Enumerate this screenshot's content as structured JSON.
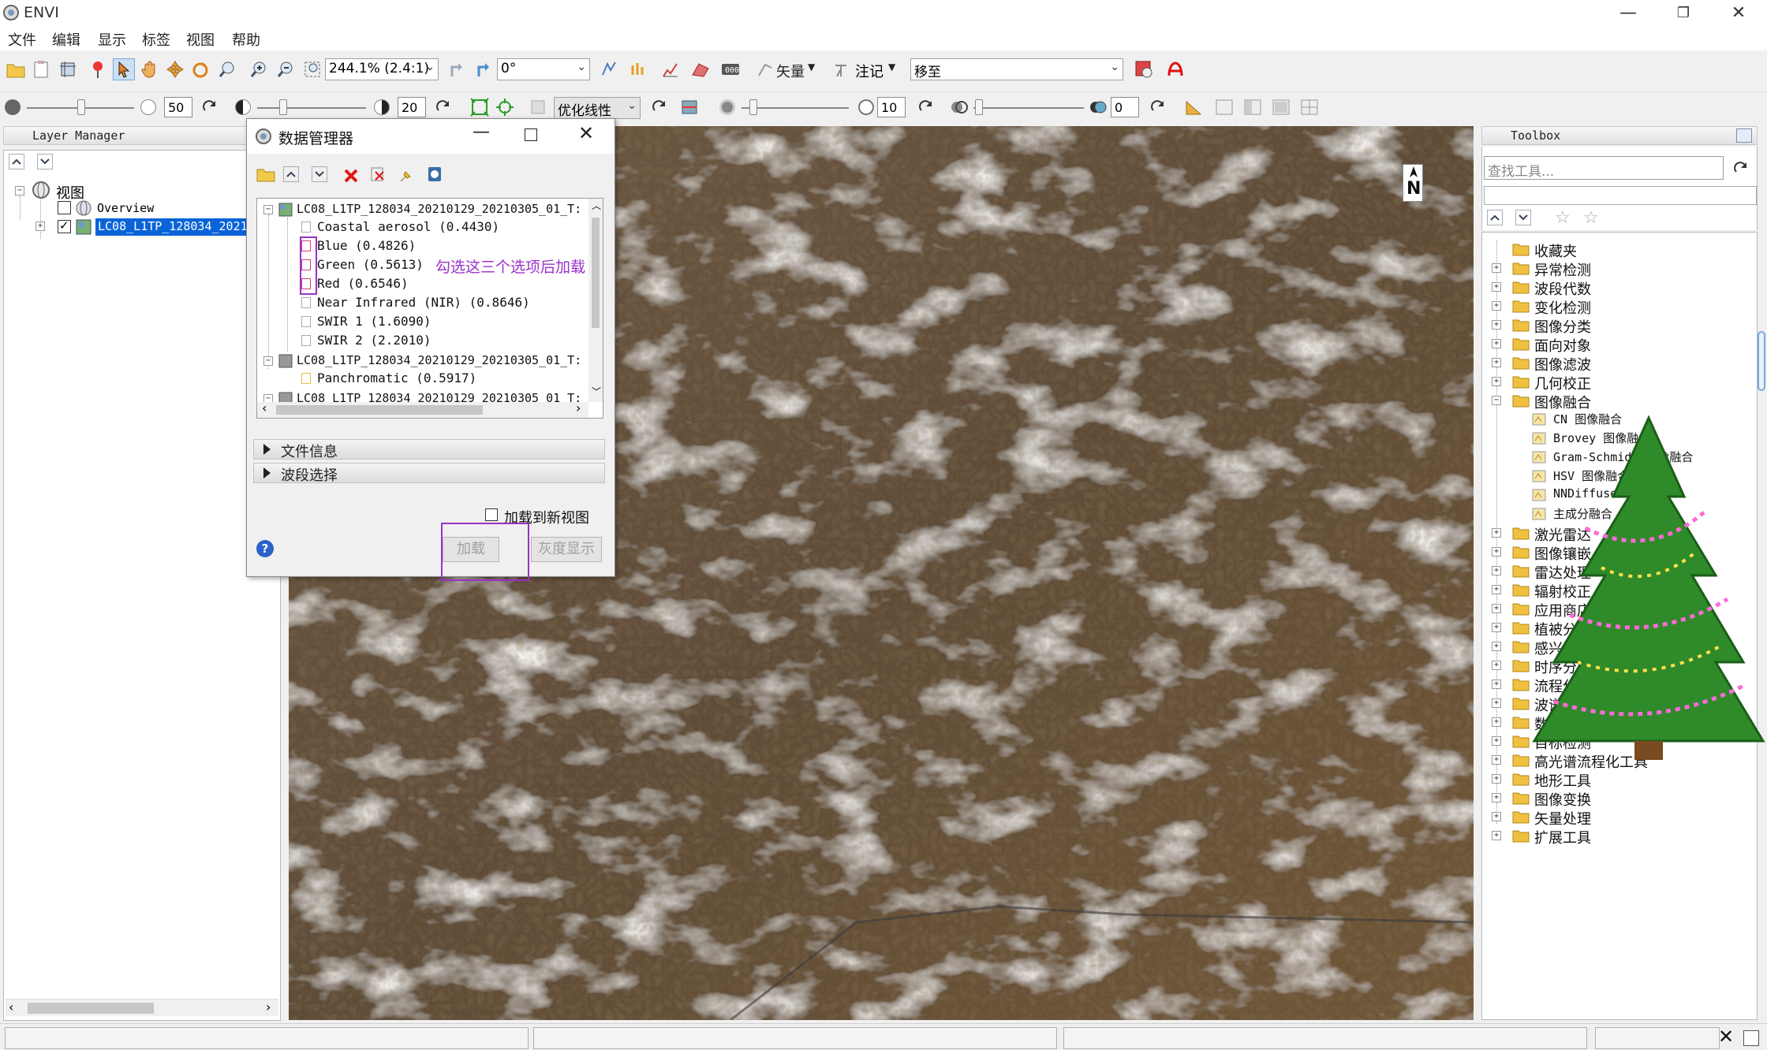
{
  "window": {
    "title": "ENVI",
    "minimize": "—",
    "restore": "❐",
    "close": "✕"
  },
  "menu": [
    "文件",
    "编辑",
    "显示",
    "标签",
    "视图",
    "帮助"
  ],
  "toolbar1": {
    "zoom_value": "244.1% (2.4:1)",
    "rotation_value": "0°",
    "vector_label": "矢量",
    "annotation_label": "注记",
    "goto_value": "移至"
  },
  "toolbar2": {
    "brightness_value": "50",
    "contrast_value": "20",
    "stretch_value": "优化线性",
    "sharpen_value": "10",
    "transparency_value": "0"
  },
  "layer_manager": {
    "title": "Layer Manager",
    "root": "视图",
    "items": [
      "Overview",
      "LC08_L1TP_128034_2021"
    ]
  },
  "data_manager": {
    "title": "数据管理器",
    "files": [
      {
        "name": "LC08_L1TP_128034_20210129_20210305_01_T:",
        "bands": [
          "Coastal aerosol (0.4430)",
          "Blue (0.4826)",
          "Green (0.5613)",
          "Red (0.6546)",
          "Near Infrared (NIR) (0.8646)",
          "SWIR 1 (1.6090)",
          "SWIR 2 (2.2010)"
        ]
      },
      {
        "name": "LC08_L1TP_128034_20210129_20210305_01_T:",
        "bands": [
          "Panchromatic (0.5917)"
        ]
      },
      {
        "name": "LC08_L1TP_128034_20210129_20210305_01_T:",
        "bands": []
      }
    ],
    "annotation": "勾选这三个选项后加载",
    "sections": [
      "文件信息",
      "波段选择"
    ],
    "load_new_view": "加载到新视图",
    "load_button": "加载",
    "gray_button": "灰度显示",
    "help": "?"
  },
  "toolbox": {
    "title": "Toolbox",
    "search_placeholder": "查找工具...",
    "folders": [
      "收藏夹",
      "异常检测",
      "波段代数",
      "变化检测",
      "图像分类",
      "面向对象",
      "图像滤波",
      "几何校正",
      "图像融合"
    ],
    "fusion_children": [
      "CN 图像融合",
      "Brovey 图像融合",
      "Gram-Schmidt 图像融合",
      "HSV 图像融合",
      "NNDiffuse",
      "主成分融合"
    ],
    "folders_after": [
      "激光雷达",
      "图像镶嵌",
      "雷达处理",
      "辐射校正",
      "应用商店",
      "植被分析",
      "感兴趣区",
      "时序分析",
      "流程化",
      "波谱分析",
      "数据统计",
      "目标检测",
      "高光谱流程化工具",
      "地形工具",
      "图像变换",
      "矢量处理",
      "扩展工具"
    ]
  },
  "map": {
    "north": "N"
  },
  "colors": {
    "accent_purple": "#9b30c8",
    "selection_blue": "#0a64d8",
    "image_base": "#5e4a34"
  }
}
